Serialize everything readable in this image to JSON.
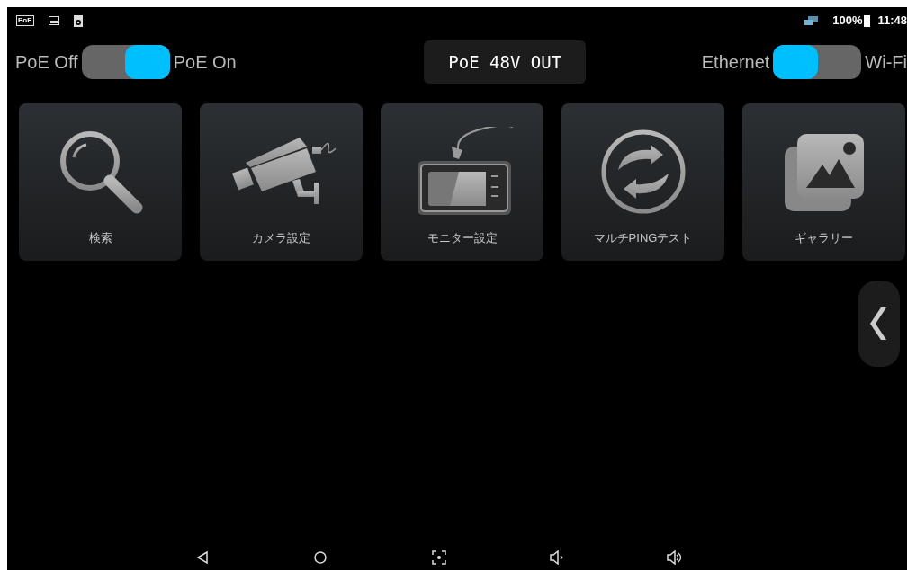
{
  "status_bar": {
    "poe_badge": "PoE",
    "battery": "100%",
    "time": "11:48"
  },
  "poe_switch": {
    "left_label": "PoE Off",
    "right_label": "PoE On",
    "on": true
  },
  "output_banner": "PoE 48V OUT",
  "network_switch": {
    "left_label": "Ethernet",
    "right_label": "Wi-Fi",
    "on": false
  },
  "tiles": [
    {
      "kind": "search",
      "label": "検索"
    },
    {
      "kind": "camera",
      "label": "カメラ設定"
    },
    {
      "kind": "monitor",
      "label": "モニター設定"
    },
    {
      "kind": "refresh",
      "label": "マルチPINGテスト"
    },
    {
      "kind": "gallery",
      "label": "ギャラリー"
    }
  ]
}
